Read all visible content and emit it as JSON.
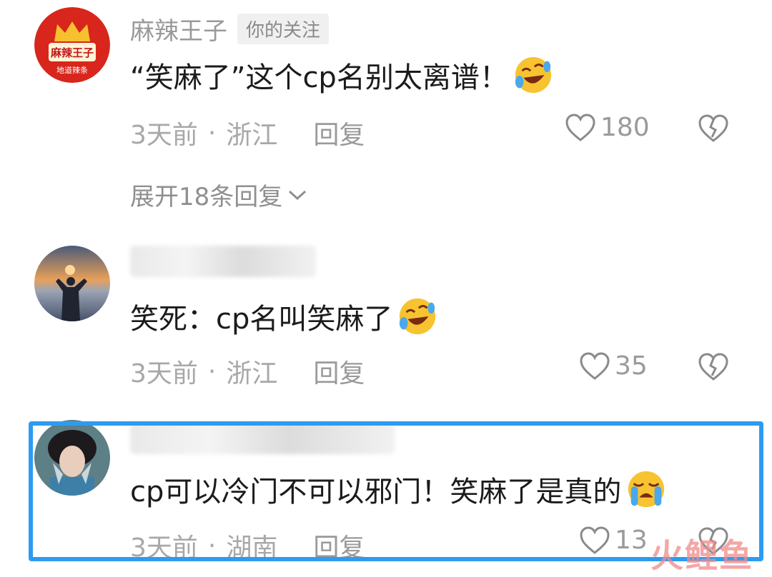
{
  "comments": [
    {
      "username": "麻辣王子",
      "follow_tag": "你的关注",
      "avatar_text_top": "麻辣王子",
      "avatar_text_bottom": "地道辣条",
      "text": "“笑麻了”这个cp名别太离谱！",
      "emoji": "laughing-crying-emoji",
      "time": "3天前",
      "separator": "·",
      "location": "浙江",
      "reply_label": "回复",
      "likes": "180",
      "expand_label": "展开18条回复"
    },
    {
      "username": "",
      "text": "笑死：cp名叫笑麻了",
      "emoji": "laughing-crying-emoji",
      "time": "3天前",
      "separator": "·",
      "location": "浙江",
      "reply_label": "回复",
      "likes": "35"
    },
    {
      "username": "",
      "text": "cp可以冷门不可以邪门！笑麻了是真的",
      "emoji": "loudly-crying-emoji",
      "time": "3天前",
      "separator": "·",
      "location": "湖南",
      "reply_label": "回复",
      "likes": "13"
    }
  ],
  "watermark": "火鲤鱼",
  "colors": {
    "highlight_border": "#2e9bf0",
    "meta_gray": "#a8a8a8",
    "brand_red": "#d8261c"
  }
}
